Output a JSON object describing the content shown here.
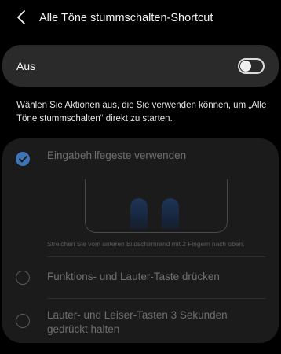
{
  "header": {
    "back_label": "Zurück",
    "title": "Alle Töne stummschalten-Shortcut"
  },
  "master": {
    "label": "Aus",
    "enabled": false
  },
  "description": "Wählen Sie Aktionen aus, die Sie verwenden können, um „Alle Töne stummschalten“ direkt zu starten.",
  "options": [
    {
      "label": "Eingabehilfegeste verwenden",
      "selected": true,
      "hint": "Streichen Sie vom unteren Bildschirmrand mit 2 Fingern nach oben."
    },
    {
      "label": "Funktions- und Lauter-Taste drücken",
      "selected": false
    },
    {
      "label": "Lauter- und Leiser-Tasten 3 Sekunden gedrückt halten",
      "selected": false
    }
  ],
  "colors": {
    "accent": "#3e74b8",
    "background": "#000000",
    "card": "#2a2a2a",
    "options_card": "#1b1b1b",
    "disabled_text": "#6f6f6f"
  }
}
